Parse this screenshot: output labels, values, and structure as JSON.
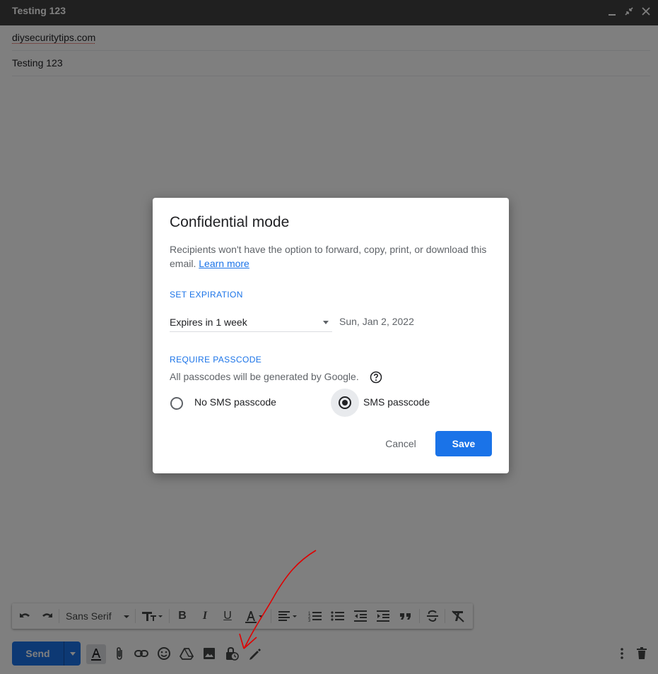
{
  "window": {
    "title": "Testing 123"
  },
  "compose": {
    "to": "diysecuritytips.com",
    "subject": "Testing 123"
  },
  "format_toolbar": {
    "font": "Sans Serif"
  },
  "bottom_bar": {
    "send_label": "Send"
  },
  "dialog": {
    "title": "Confidential mode",
    "description": "Recipients won't have the option to forward, copy, print, or download this email.",
    "learn_more": "Learn more",
    "set_expiration_label": "SET EXPIRATION",
    "expiration_selected": "Expires in 1 week",
    "expiration_date": "Sun, Jan 2, 2022",
    "require_passcode_label": "REQUIRE PASSCODE",
    "passcode_note": "All passcodes will be generated by Google.",
    "options": [
      "No SMS passcode",
      "SMS passcode"
    ],
    "selected_option": "SMS passcode",
    "cancel_label": "Cancel",
    "save_label": "Save"
  },
  "colors": {
    "accent": "#1a73e8",
    "titlebar": "#404040",
    "annotation": "#e00000"
  }
}
